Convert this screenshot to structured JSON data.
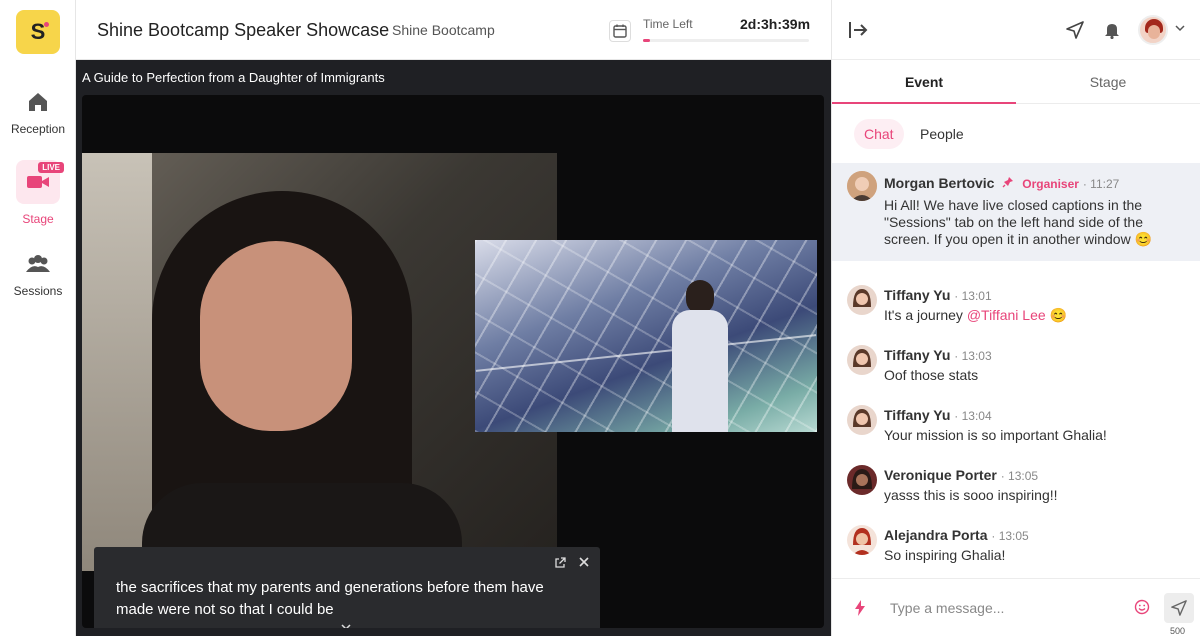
{
  "rail": {
    "logo": "S",
    "items": [
      {
        "label": "Reception",
        "icon": "home-icon"
      },
      {
        "label": "Stage",
        "icon": "video-camera-icon",
        "badge": "LIVE",
        "active": true
      },
      {
        "label": "Sessions",
        "icon": "group-icon"
      }
    ]
  },
  "header": {
    "title": "Shine Bootcamp Speaker Showcase",
    "subtitle": "Shine Bootcamp",
    "time_left_label": "Time Left",
    "time_left_value": "2d:3h:39m",
    "time_left_progress": 0.04
  },
  "video": {
    "title": "A Guide to Perfection from a Daughter of Immigrants",
    "caption": "the sacrifices that my parents and generations before them have made were not so that I could be"
  },
  "panel": {
    "tabs": [
      {
        "label": "Event",
        "active": true
      },
      {
        "label": "Stage",
        "active": false
      }
    ],
    "subtabs": [
      {
        "label": "Chat",
        "active": true
      },
      {
        "label": "People",
        "active": false
      }
    ],
    "messages": [
      {
        "name": "Morgan Bertovic",
        "role": "Organiser",
        "time": "· 11:27",
        "text": "Hi All! We have live closed captions in the \"Sessions\" tab on the left hand side of the screen. If you open it in another window 😊",
        "pinned": true
      },
      {
        "name": "Tiffany Yu",
        "time": "· 13:01",
        "text": "It's a journey ",
        "mention": "@Tiffani Lee",
        "emoji": " 😊"
      },
      {
        "name": "Tiffany Yu",
        "time": "· 13:03",
        "text": "Oof those stats"
      },
      {
        "name": "Tiffany Yu",
        "time": "· 13:04",
        "text": "Your mission is so important Ghalia!"
      },
      {
        "name": "Veronique Porter",
        "time": "· 13:05",
        "text": "yasss this is sooo inspiring!!"
      },
      {
        "name": "Alejandra Porta",
        "time": "· 13:05",
        "text": "So inspiring Ghalia!"
      }
    ],
    "composer": {
      "placeholder": "Type a message...",
      "char_limit": "500"
    }
  },
  "colors": {
    "accent": "#e8457a",
    "logo_bg": "#f7d54a"
  }
}
